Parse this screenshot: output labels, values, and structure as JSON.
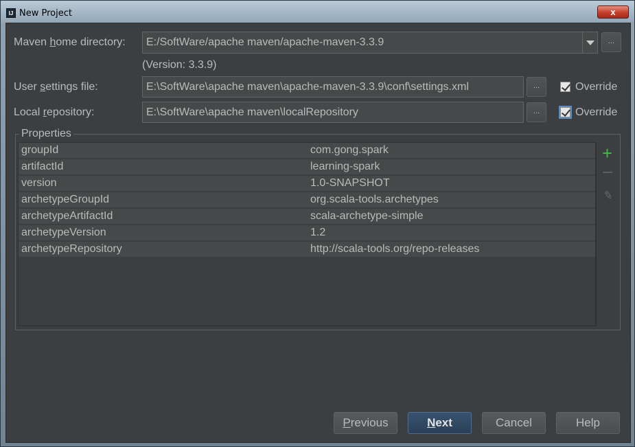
{
  "window": {
    "title": "New Project",
    "icon_text": "IJ",
    "close_label": "x"
  },
  "maven_home": {
    "label_pre": "Maven ",
    "label_mn": "h",
    "label_post": "ome directory:",
    "value": "E:/SoftWare/apache maven/apache-maven-3.3.9",
    "version": "(Version: 3.3.9)"
  },
  "user_settings": {
    "label_pre": "User ",
    "label_mn": "s",
    "label_post": "ettings file:",
    "value": "E:\\SoftWare\\apache maven\\apache-maven-3.3.9\\conf\\settings.xml",
    "override_label": "Override",
    "override_checked": true
  },
  "local_repo": {
    "label_pre": "Local ",
    "label_mn": "r",
    "label_post": "epository:",
    "value": "E:\\SoftWare\\apache maven\\localRepository",
    "override_label": "Override",
    "override_checked": true
  },
  "browse_label": "...",
  "properties": {
    "legend": "Properties",
    "rows": [
      {
        "key": "groupId",
        "value": "com.gong.spark"
      },
      {
        "key": "artifactId",
        "value": "learning-spark"
      },
      {
        "key": "version",
        "value": "1.0-SNAPSHOT"
      },
      {
        "key": "archetypeGroupId",
        "value": "org.scala-tools.archetypes"
      },
      {
        "key": "archetypeArtifactId",
        "value": "scala-archetype-simple"
      },
      {
        "key": "archetypeVersion",
        "value": "1.2"
      },
      {
        "key": "archetypeRepository",
        "value": "http://scala-tools.org/repo-releases"
      }
    ],
    "tools": {
      "add": "+",
      "edit": "✎"
    }
  },
  "buttons": {
    "previous_mn": "P",
    "previous_rest": "revious",
    "next_mn": "N",
    "next_rest": "ext",
    "cancel": "Cancel",
    "help": "Help"
  },
  "colors": {
    "background": "#3c3f41",
    "field": "#45494a",
    "text": "#bbbbbb",
    "primary_button": "#2c4058",
    "add_icon": "#4ab44a"
  }
}
